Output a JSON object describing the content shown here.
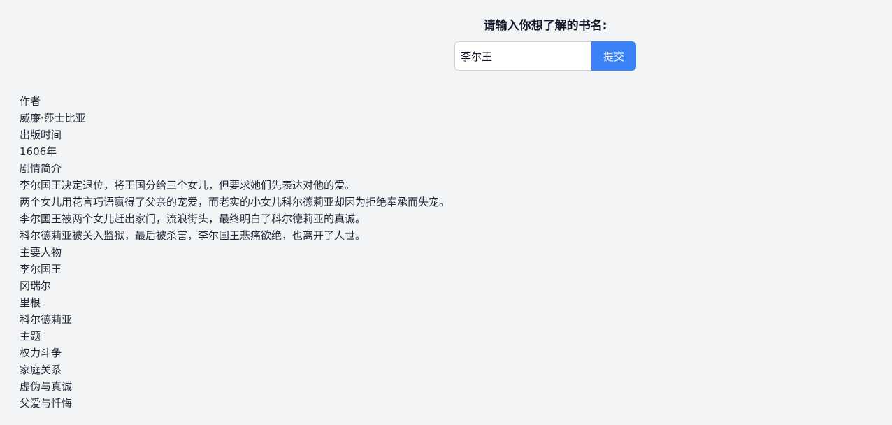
{
  "form": {
    "title": "请输入你想了解的书名:",
    "input_value": "李尔王",
    "submit_label": "提交"
  },
  "result": {
    "author": {
      "heading": "作者",
      "value": "威廉·莎士比亚"
    },
    "publish_time": {
      "heading": "出版时间",
      "value": "1606年"
    },
    "synopsis": {
      "heading": "剧情简介",
      "lines": [
        "李尔国王决定退位，将王国分给三个女儿，但要求她们先表达对他的爱。",
        "两个女儿用花言巧语赢得了父亲的宠爱，而老实的小女儿科尔德莉亚却因为拒绝奉承而失宠。",
        "李尔国王被两个女儿赶出家门，流浪街头，最终明白了科尔德莉亚的真诚。",
        "科尔德莉亚被关入监狱，最后被杀害，李尔国王悲痛欲绝，也离开了人世。"
      ]
    },
    "characters": {
      "heading": "主要人物",
      "items": [
        "李尔国王",
        "冈瑞尔",
        "里根",
        "科尔德莉亚"
      ]
    },
    "themes": {
      "heading": "主题",
      "items": [
        "权力斗争",
        "家庭关系",
        "虚伪与真诚",
        "父爱与忏悔"
      ]
    }
  }
}
